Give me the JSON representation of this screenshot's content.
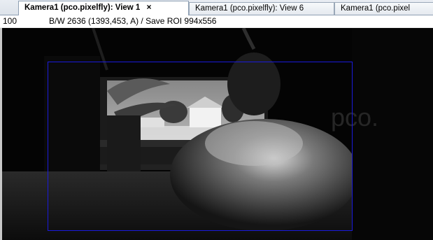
{
  "tabs": [
    {
      "label": "Kamera1 (pco.pixelfly): View 1",
      "active": true,
      "close": "×"
    },
    {
      "label": "Kamera1 (pco.pixelfly): View 6",
      "active": false
    },
    {
      "label": "Kamera1 (pco.pixel",
      "active": false
    }
  ],
  "status": {
    "zoom": "100",
    "info": "B/W 2636 (1393,453, A) / Save ROI 994x556"
  },
  "image": {
    "watermark": "pco."
  },
  "colors": {
    "roi_border": "#1a1adc",
    "tab_border": "#8e9fb3"
  }
}
